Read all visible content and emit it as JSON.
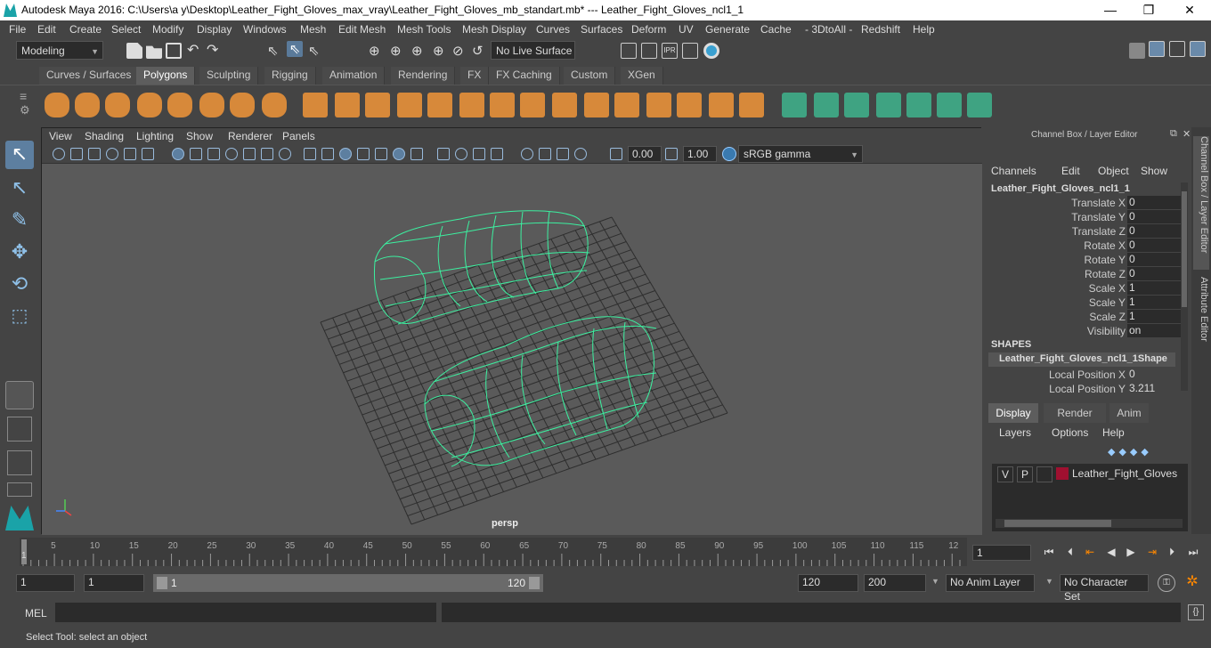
{
  "window": {
    "title": "Autodesk Maya 2016: C:\\Users\\a y\\Desktop\\Leather_Fight_Gloves_max_vray\\Leather_Fight_Gloves_mb_standart.mb*   ---   Leather_Fight_Gloves_ncl1_1",
    "minimize": "—",
    "maximize": "❐",
    "close": "✕"
  },
  "menubar": [
    "File",
    "Edit",
    "Create",
    "Select",
    "Modify",
    "Display",
    "Windows",
    "Mesh",
    "Edit Mesh",
    "Mesh Tools",
    "Mesh Display",
    "Curves",
    "Surfaces",
    "Deform",
    "UV",
    "Generate",
    "Cache",
    "- 3DtoAll -",
    "Redshift",
    "Help"
  ],
  "statusline": {
    "mode": "Modeling",
    "live_surface": "No Live Surface"
  },
  "shelf_tabs": [
    "Curves / Surfaces",
    "Polygons",
    "Sculpting",
    "Rigging",
    "Animation",
    "Rendering",
    "FX",
    "FX Caching",
    "Custom",
    "XGen"
  ],
  "shelf_active": "Polygons",
  "viewport": {
    "menu": [
      "View",
      "Shading",
      "Lighting",
      "Show",
      "Renderer",
      "Panels"
    ],
    "exposure": "0.00",
    "gamma": "1.00",
    "colorspace": "sRGB gamma",
    "camera_label": "persp"
  },
  "channel_box": {
    "header": "Channel Box / Layer Editor",
    "menu": [
      "Channels",
      "Edit",
      "Object",
      "Show"
    ],
    "object_name": "Leather_Fight_Gloves_ncl1_1",
    "attributes": [
      {
        "label": "Translate X",
        "value": "0"
      },
      {
        "label": "Translate Y",
        "value": "0"
      },
      {
        "label": "Translate Z",
        "value": "0"
      },
      {
        "label": "Rotate X",
        "value": "0"
      },
      {
        "label": "Rotate Y",
        "value": "0"
      },
      {
        "label": "Rotate Z",
        "value": "0"
      },
      {
        "label": "Scale X",
        "value": "1"
      },
      {
        "label": "Scale Y",
        "value": "1"
      },
      {
        "label": "Scale Z",
        "value": "1"
      },
      {
        "label": "Visibility",
        "value": "on"
      }
    ],
    "shapes_header": "SHAPES",
    "shape_name": "Leather_Fight_Gloves_ncl1_1Shape",
    "shape_attributes": [
      {
        "label": "Local Position X",
        "value": "0"
      },
      {
        "label": "Local Position Y",
        "value": "3.211"
      }
    ]
  },
  "layer_editor": {
    "tabs": [
      "Display",
      "Render",
      "Anim"
    ],
    "active_tab": "Display",
    "menu": [
      "Layers",
      "Options",
      "Help"
    ],
    "layer": {
      "v": "V",
      "p": "P",
      "name": "Leather_Fight_Gloves",
      "color": "#a01030"
    }
  },
  "side_tabs": [
    "Channel Box / Layer Editor",
    "Attribute Editor"
  ],
  "timeline": {
    "ticks": [
      "5",
      "10",
      "15",
      "20",
      "25",
      "30",
      "35",
      "40",
      "45",
      "50",
      "55",
      "60",
      "65",
      "70",
      "75",
      "80",
      "85",
      "90",
      "95",
      "100",
      "105",
      "110",
      "115",
      "12"
    ],
    "start_label": "1",
    "current_frame": "1"
  },
  "range": {
    "start": "1",
    "playback_start": "1",
    "slider_start": "1",
    "slider_end": "120",
    "playback_end": "120",
    "end": "200",
    "anim_layer": "No Anim Layer",
    "character_set": "No Character Set"
  },
  "mel": {
    "label": "MEL"
  },
  "help_line": "Select Tool: select an object",
  "colors": {
    "wire": "#3cf0a0",
    "shelf_orange": "#e8913a",
    "shelf_green": "#3fae8a"
  }
}
